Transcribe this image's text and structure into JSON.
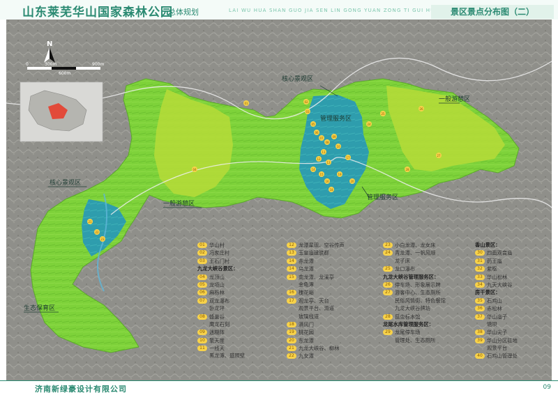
{
  "header": {
    "title": "山东莱芜华山国家森林公园",
    "subtitle": "总体规划",
    "pinyin": "LAI WU HUA SHAN GUO JIA SEN LIN GONG YUAN ZONG TI GUI HUA",
    "sheet_title": "景区景点分布图（二）"
  },
  "map": {
    "scale_labels": [
      "0",
      "300m",
      "600m",
      "900m"
    ],
    "zone_labels": {
      "core_center": "核心景观区",
      "core_west": "核心景观区",
      "general_east": "一般游憩区",
      "general_west": "一般游憩区",
      "service_center": "管理服务区",
      "service_south": "管理服务区",
      "ecology": "生态保育区"
    },
    "markers": [
      "01",
      "02",
      "03",
      "04",
      "05",
      "06",
      "07",
      "08",
      "09",
      "10",
      "11",
      "12",
      "13",
      "14",
      "15",
      "16",
      "17",
      "18",
      "19",
      "20",
      "21",
      "22",
      "23",
      "24",
      "25",
      "26",
      "27",
      "28",
      "29",
      "30",
      "31",
      "32",
      "33",
      "34",
      "35",
      "36",
      "37",
      "38",
      "39",
      "40"
    ],
    "colors": {
      "ecology_green": "#7ed23a",
      "core_blue": "#2a9ab3",
      "general_lime": "#b6dc38",
      "base_gray": "#8f8f8a",
      "marker_yellow": "#f7d24a"
    }
  },
  "legend": {
    "col1": [
      {
        "num": "01",
        "text": "华山村"
      },
      {
        "num": "02",
        "text": "冯家庄村"
      },
      {
        "num": "03",
        "text": "王石门村"
      },
      {
        "header": "九龙大峡谷景区："
      },
      {
        "num": "04",
        "text": "龙顶山"
      },
      {
        "num": "05",
        "text": "龙项山"
      },
      {
        "num": "06",
        "text": "麻栎林"
      },
      {
        "num": "07",
        "text": "双龙瀑布"
      },
      {
        "indent": "卧龙坪"
      },
      {
        "num": "08",
        "text": "蜂巢谷"
      },
      {
        "indent": "鹰龙石刻"
      },
      {
        "num": "09",
        "text": "迷糊阵"
      },
      {
        "num": "10",
        "text": "擎天崖"
      },
      {
        "num": "11",
        "text": "一线天"
      },
      {
        "indent": "黑龙潭、题照壁"
      }
    ],
    "col2": [
      {
        "num": "12",
        "text": "龙潭星现、空谷传声"
      },
      {
        "num": "13",
        "text": "玉皇庙建筑群"
      },
      {
        "num": "14",
        "text": "赤龙潭"
      },
      {
        "num": "14",
        "text": "乌龙潭"
      },
      {
        "num": "15",
        "text": "南龙潭、龙溪亭"
      },
      {
        "indent": "金龟潭"
      },
      {
        "num": "16",
        "text": "槐花峪"
      },
      {
        "num": "17",
        "text": "观龙亭、天台"
      },
      {
        "indent": "观景平台、滑道"
      },
      {
        "indent": "玻璃栈道"
      },
      {
        "num": "18",
        "text": "满风门"
      },
      {
        "num": "19",
        "text": "桃花园"
      },
      {
        "num": "20",
        "text": "东龙潭"
      },
      {
        "num": "21",
        "text": "九龙大峡谷、柳林"
      },
      {
        "num": "22",
        "text": "九女潭"
      }
    ],
    "col3": [
      {
        "num": "23",
        "text": "小白龙潭、龙女床"
      },
      {
        "num": "24",
        "text": "青龙潭、一帆风顺"
      },
      {
        "indent": "龙子床"
      },
      {
        "num": "25",
        "text": "龙口瀑布"
      },
      {
        "header": "九龙大峡谷管理服务区："
      },
      {
        "num": "26",
        "text": "停车场、形象展示牌"
      },
      {
        "num": "27",
        "text": "游客中心、生态厕所"
      },
      {
        "indent": "民俗风情街、特色餐馆"
      },
      {
        "indent": "九龙大峡谷牌坊"
      },
      {
        "num": "28",
        "text": "昆虫标本馆"
      },
      {
        "header": "龙尾水库管理服务区："
      },
      {
        "num": "29",
        "text": "龙尾停车场"
      },
      {
        "indent": "管理处、生态厕所"
      }
    ],
    "col4": [
      {
        "header": "香山景区："
      },
      {
        "num": "30",
        "text": "四面观音庙"
      },
      {
        "num": "31",
        "text": "药王庙"
      },
      {
        "num": "32",
        "text": "紫枢"
      },
      {
        "num": "33",
        "text": "华山松林"
      },
      {
        "num": "34",
        "text": "九天大峡谷"
      },
      {
        "header": "房干景区："
      },
      {
        "num": "35",
        "text": "石鸡山"
      },
      {
        "num": "36",
        "text": "赤松林"
      },
      {
        "num": "37",
        "text": "华山庙子"
      },
      {
        "indent": "塘坝"
      },
      {
        "num": "38",
        "text": "华山尖子"
      },
      {
        "num": "39",
        "text": "华山分区驻地"
      },
      {
        "indent": "观景平台"
      },
      {
        "num": "40",
        "text": "石鸡山管理处"
      }
    ]
  },
  "footer": {
    "company": "济南新绿豪设计有限公司",
    "page": "09"
  }
}
